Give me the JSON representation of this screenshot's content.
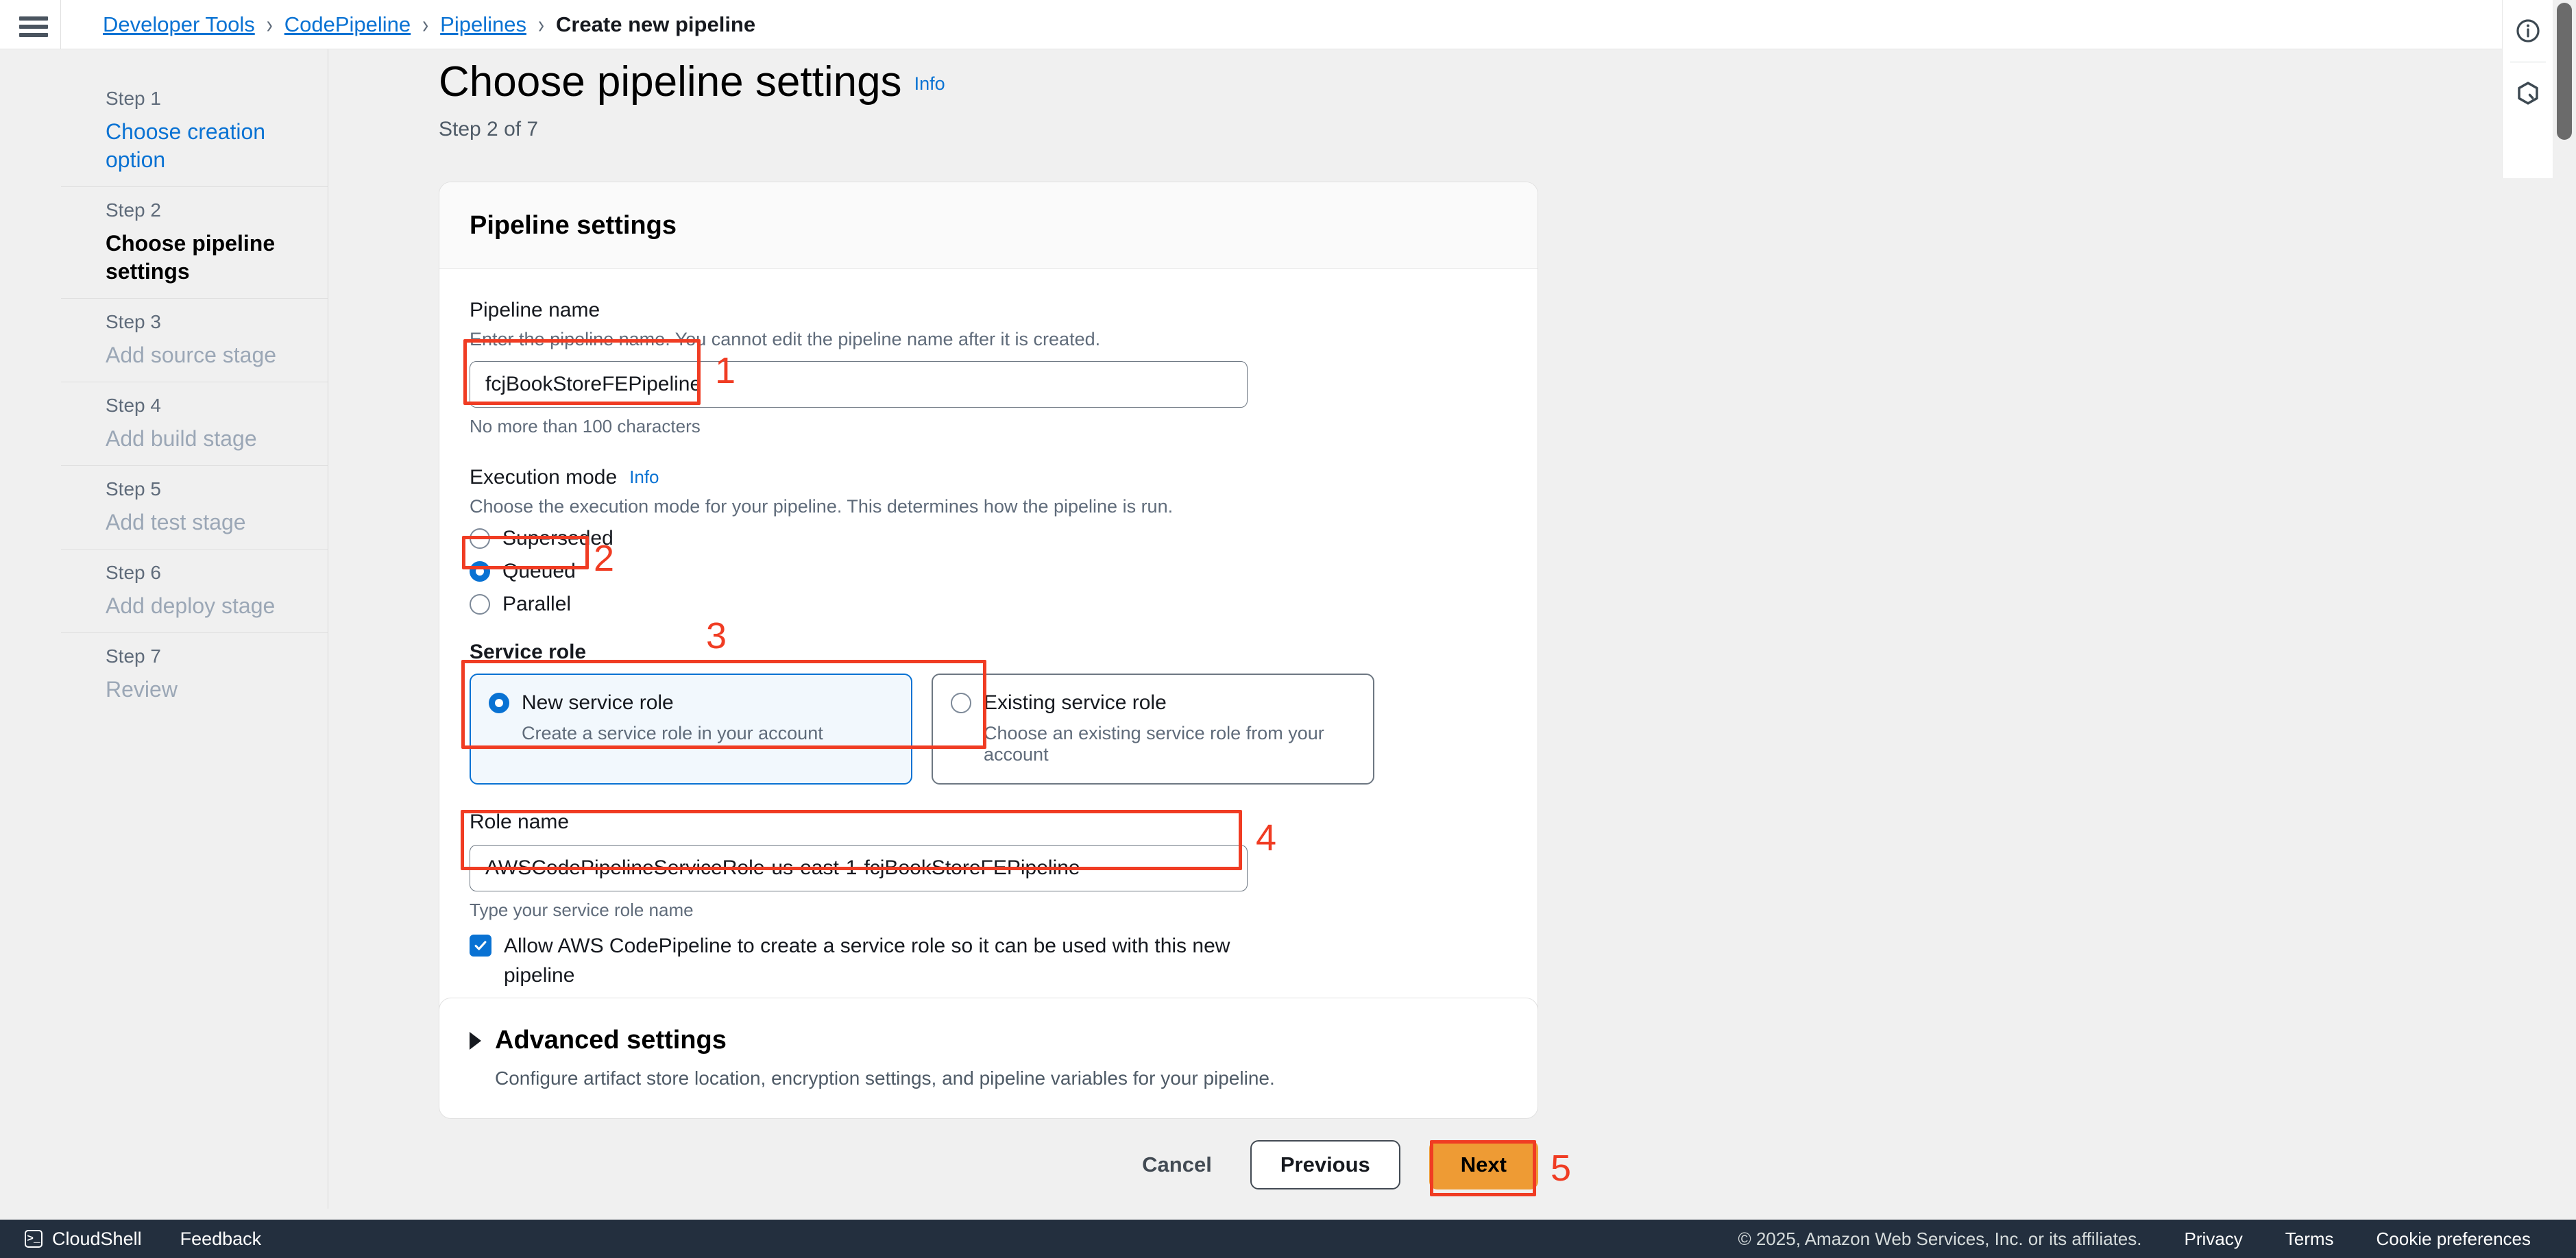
{
  "breadcrumb": {
    "items": [
      {
        "label": "Developer Tools",
        "link": true
      },
      {
        "label": "CodePipeline",
        "link": true
      },
      {
        "label": "Pipelines",
        "link": true
      },
      {
        "label": "Create new pipeline",
        "link": false
      }
    ],
    "separator": "›"
  },
  "sidebar": {
    "steps": [
      {
        "num": "Step 1",
        "label": "Choose creation option",
        "state": "link"
      },
      {
        "num": "Step 2",
        "label": "Choose pipeline settings",
        "state": "active"
      },
      {
        "num": "Step 3",
        "label": "Add source stage",
        "state": "disabled"
      },
      {
        "num": "Step 4",
        "label": "Add build stage",
        "state": "disabled"
      },
      {
        "num": "Step 5",
        "label": "Add test stage",
        "state": "disabled"
      },
      {
        "num": "Step 6",
        "label": "Add deploy stage",
        "state": "disabled"
      },
      {
        "num": "Step 7",
        "label": "Review",
        "state": "disabled"
      }
    ]
  },
  "header": {
    "title": "Choose pipeline settings",
    "info_label": "Info",
    "subtitle": "Step 2 of 7"
  },
  "card": {
    "title": "Pipeline settings",
    "pipeline_name": {
      "label": "Pipeline name",
      "description": "Enter the pipeline name. You cannot edit the pipeline name after it is created.",
      "value": "fcjBookStoreFEPipeline",
      "constraint": "No more than 100 characters"
    },
    "execution_mode": {
      "label": "Execution mode",
      "info_label": "Info",
      "description": "Choose the execution mode for your pipeline. This determines how the pipeline is run.",
      "options": [
        {
          "label": "Superseded",
          "selected": false
        },
        {
          "label": "Queued",
          "selected": true
        },
        {
          "label": "Parallel",
          "selected": false
        }
      ]
    },
    "service_role": {
      "label": "Service role",
      "options": [
        {
          "title": "New service role",
          "desc": "Create a service role in your account",
          "selected": true
        },
        {
          "title": "Existing service role",
          "desc": "Choose an existing service role from your account",
          "selected": false
        }
      ]
    },
    "role_name": {
      "label": "Role name",
      "value": "AWSCodePipelineServiceRole-us-east-1-fcjBookStoreFEPipeline",
      "hint": "Type your service role name",
      "checkbox_label": "Allow AWS CodePipeline to create a service role so it can be used with this new pipeline",
      "checkbox_checked": true
    }
  },
  "advanced": {
    "title": "Advanced settings",
    "description": "Configure artifact store location, encryption settings, and pipeline variables for your pipeline.",
    "expanded": false
  },
  "actions": {
    "cancel": "Cancel",
    "previous": "Previous",
    "next": "Next"
  },
  "bottombar": {
    "cloudshell": "CloudShell",
    "cloudshell_glyph": ">_",
    "feedback": "Feedback",
    "copyright": "© 2025, Amazon Web Services, Inc. or its affiliates.",
    "privacy": "Privacy",
    "terms": "Terms",
    "cookies": "Cookie preferences"
  },
  "annotations": {
    "colors": {
      "red": "#f03c23",
      "accent_blue": "#0972d3",
      "orange": "#ee9b34"
    },
    "markers": [
      {
        "num": "1",
        "target": "pipeline-name-input"
      },
      {
        "num": "2",
        "target": "execution-mode-queued"
      },
      {
        "num": "3",
        "target": "service-role-new-tile"
      },
      {
        "num": "4",
        "target": "role-name-input"
      },
      {
        "num": "5",
        "target": "next-button"
      }
    ]
  }
}
